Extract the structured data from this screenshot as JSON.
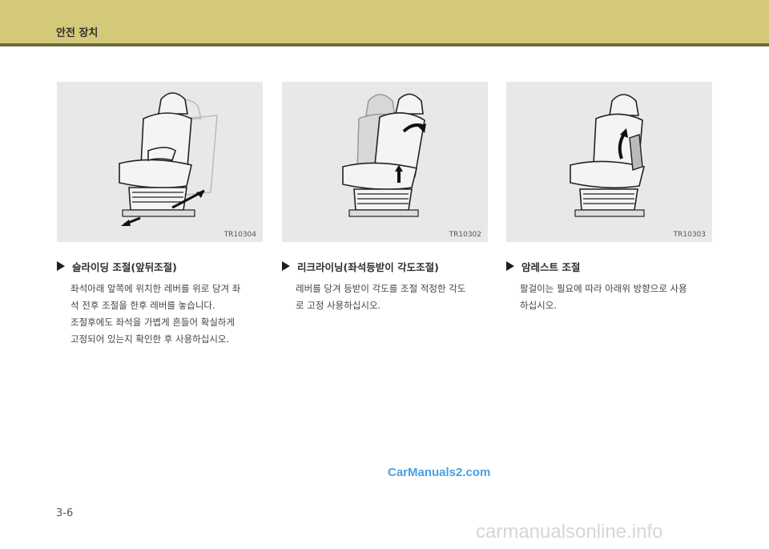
{
  "header": {
    "section_title": "안전 장치",
    "band_color": "#d4c979",
    "rule_color": "#6d6a3c"
  },
  "figures": [
    {
      "code": "TR10304"
    },
    {
      "code": "TR10302"
    },
    {
      "code": "TR10303"
    }
  ],
  "columns": [
    {
      "heading": "슬라이딩 조절(앞뒤조절)",
      "lines": [
        "좌석아래 앞쪽에 위치한 레버를 위로 당겨 좌",
        "석 전후 조절을 한후 레버를 놓습니다.",
        "조절후에도 좌석을 가볍게 흔들어 확실하게",
        "고정되어 있는지 확인한 후 사용하십시오."
      ]
    },
    {
      "heading": "리크라이닝(좌석등받이 각도조절)",
      "lines": [
        "레버를 당겨 등받이 각도를 조절 적정한 각도",
        "로 고정 사용하십시오."
      ]
    },
    {
      "heading": "암레스트 조절",
      "lines": [
        "팔걸이는 필요에 따라 아래위 방향으로 사용",
        "하십시오."
      ]
    }
  ],
  "watermark": "CarManuals2.com",
  "page_number": "3-6",
  "footer_mark": "carmanualsonline.info"
}
